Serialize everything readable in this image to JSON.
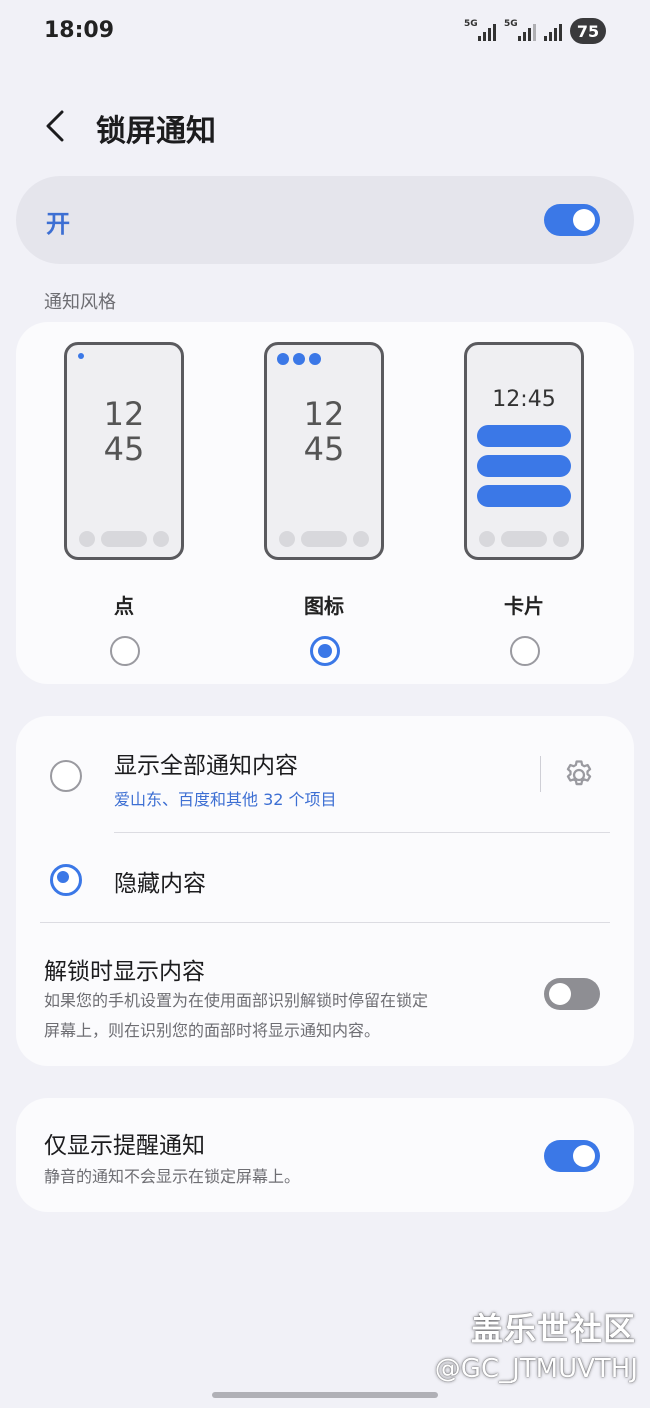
{
  "status_bar": {
    "time": "18:09",
    "sim1_label": "5G",
    "sim2_label": "5G",
    "battery": "75"
  },
  "header": {
    "title": "锁屏通知"
  },
  "master_switch": {
    "label": "开",
    "on": true
  },
  "notification_style": {
    "section_label": "通知风格",
    "options": [
      {
        "label": "点",
        "selected": false
      },
      {
        "label": "图标",
        "selected": true,
        "clock": "12\n45"
      },
      {
        "label": "卡片",
        "selected": false,
        "clock": "12:45"
      }
    ],
    "preview_clock_hour": "12",
    "preview_clock_min": "45",
    "preview_clock_inline": "12:45"
  },
  "content": {
    "show_all": {
      "title": "显示全部通知内容",
      "subtitle": "爱山东、百度和其他 32 个项目",
      "selected": false
    },
    "hide": {
      "title": "隐藏内容",
      "selected": true
    },
    "unlock_show": {
      "title": "解锁时显示内容",
      "desc_line1": "如果您的手机设置为在使用面部识别解锁时停留在锁定",
      "desc_line2": "屏幕上，则在识别您的面部时将显示通知内容。",
      "on": false
    }
  },
  "reminder": {
    "title": "仅显示提醒通知",
    "desc": "静音的通知不会显示在锁定屏幕上。",
    "on": true
  },
  "watermark": {
    "line1": "盖乐世社区",
    "line2": "@GC_JTMUVTHJ"
  },
  "colors": {
    "accent": "#3b78e7",
    "background": "#f1f1f7",
    "card": "#fbfbfd"
  }
}
